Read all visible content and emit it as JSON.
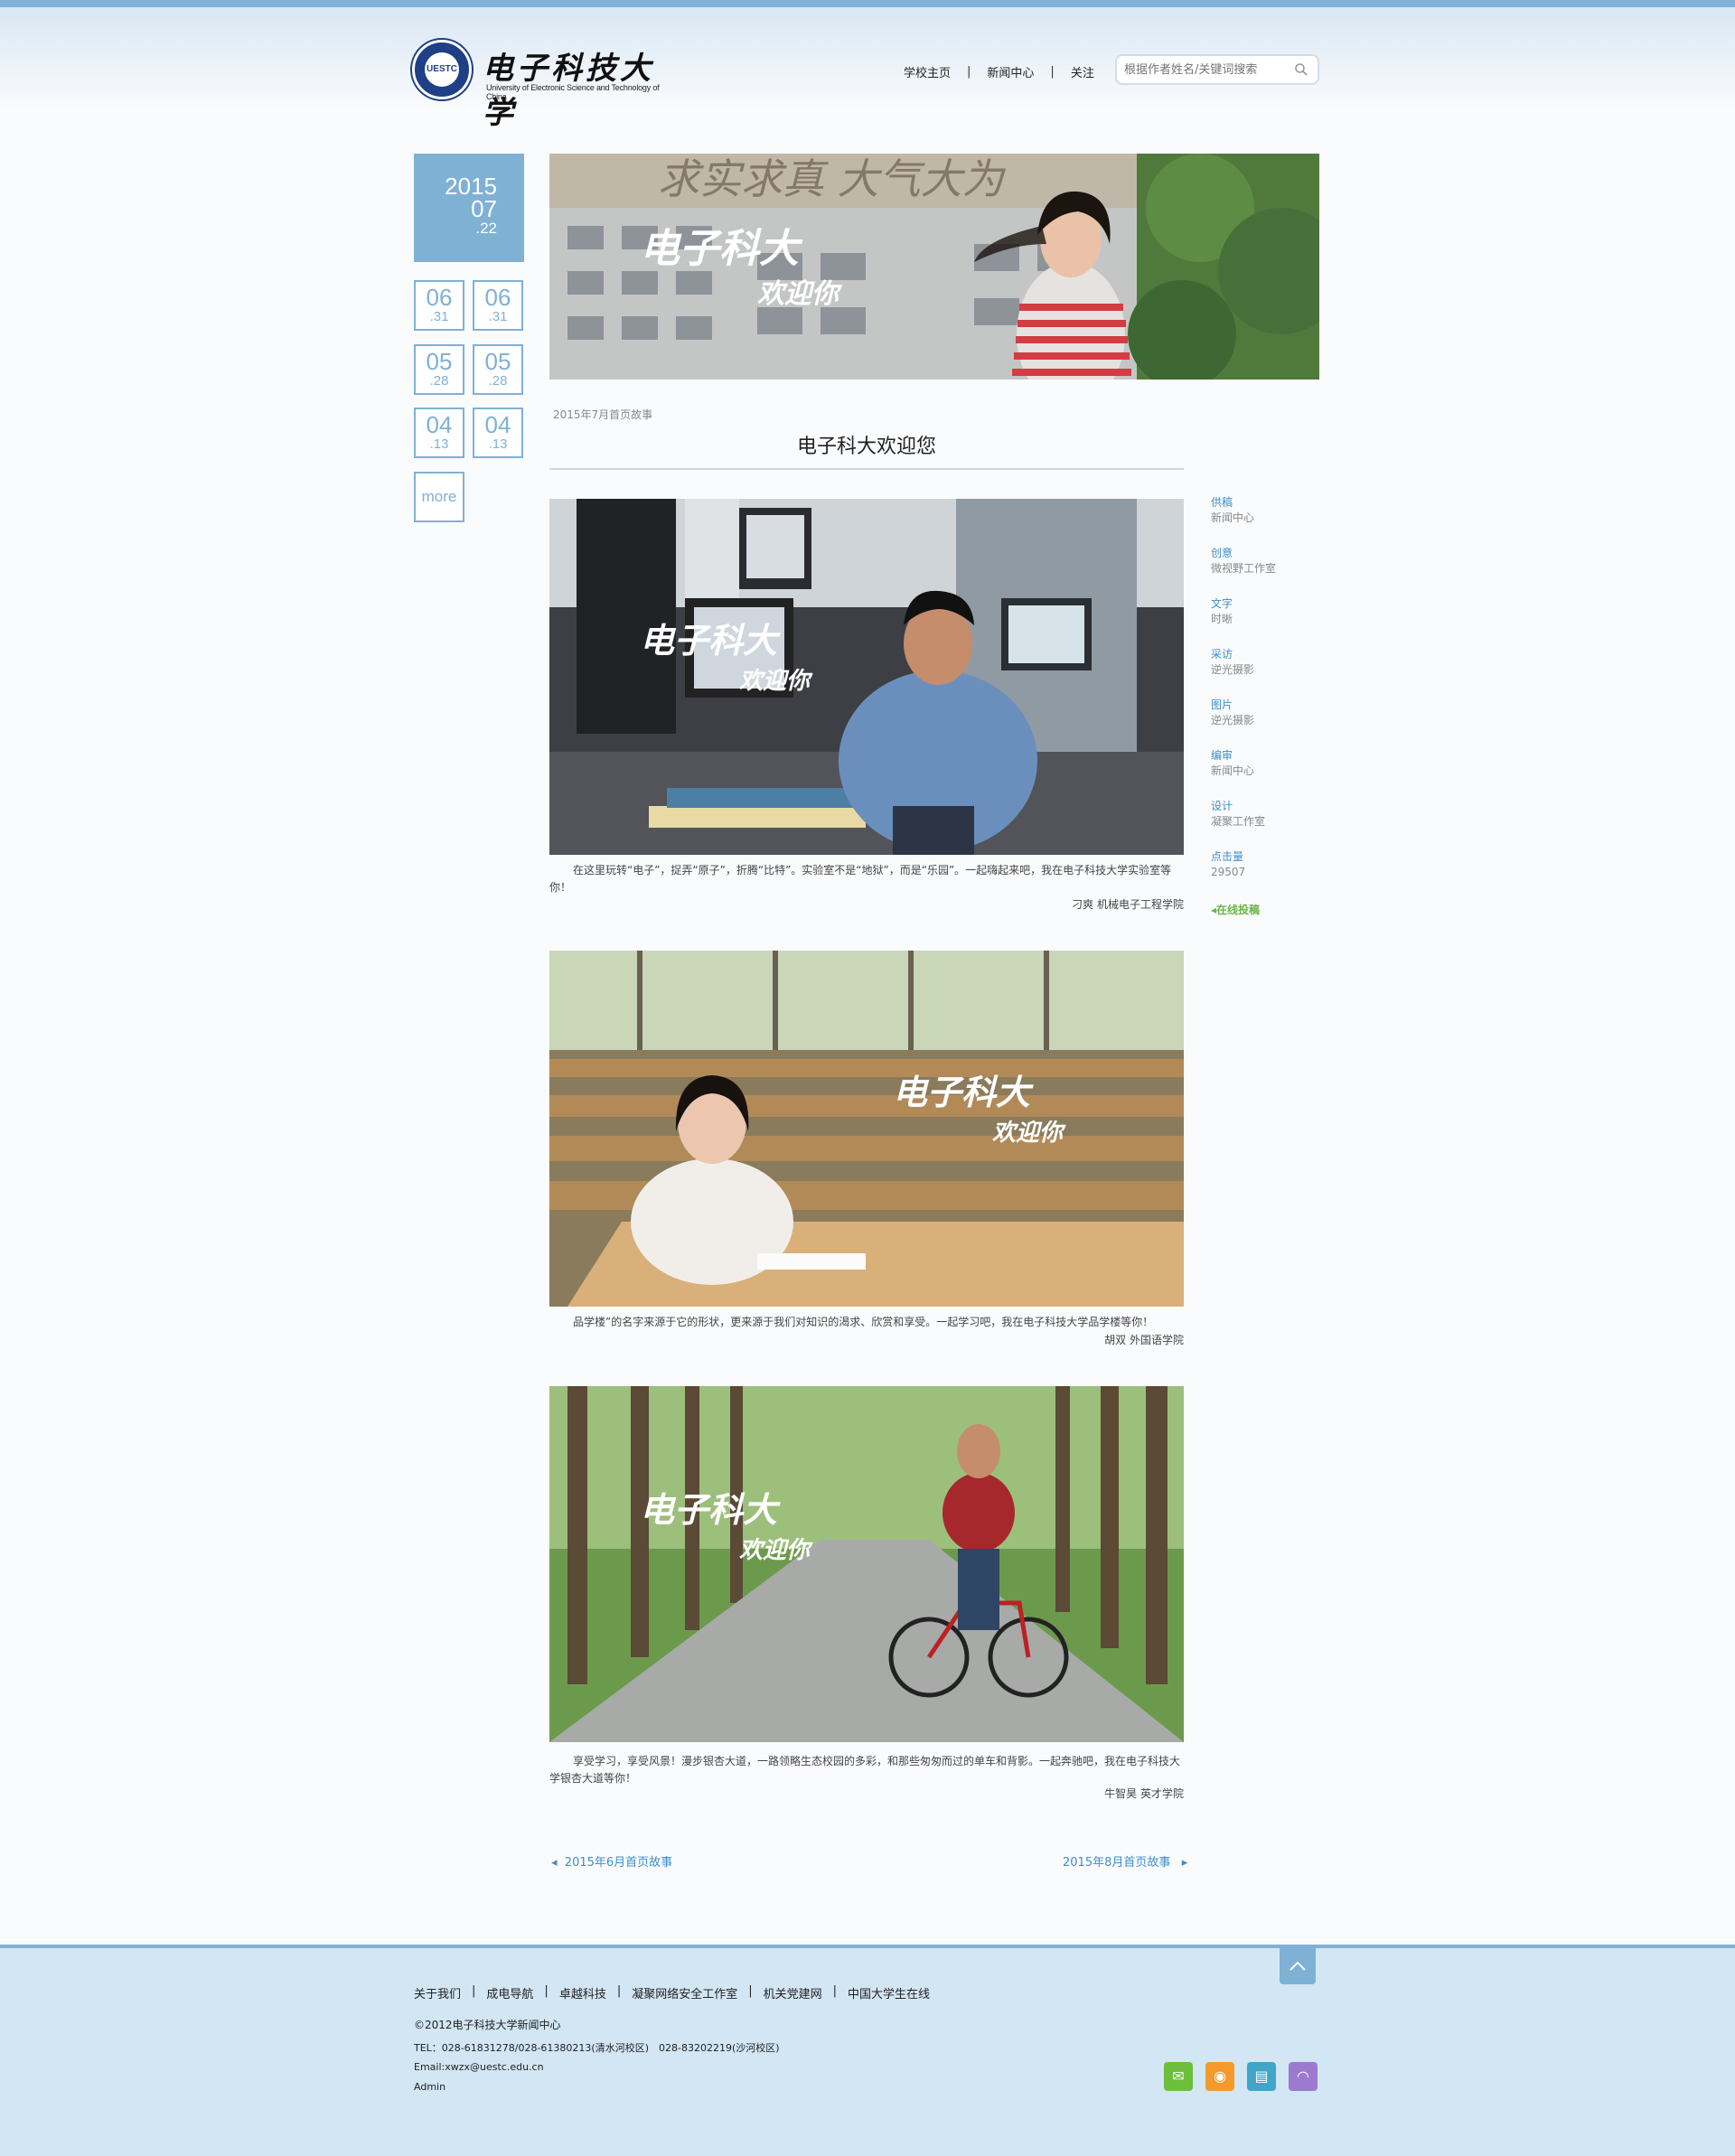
{
  "header": {
    "logo_cn": "电子科技大学",
    "logo_en": "University of Electronic Science and Technology of China",
    "logo_badge": "UESTC",
    "nav": [
      "学校主页",
      "新闻中心",
      "关注"
    ],
    "search_placeholder": "根据作者姓名/关键词搜索"
  },
  "dates": {
    "current": {
      "year": "2015",
      "month": "07",
      "day": ".22"
    },
    "archive": [
      {
        "month": "06",
        "day": ".31"
      },
      {
        "month": "06",
        "day": ".31"
      },
      {
        "month": "05",
        "day": ".28"
      },
      {
        "month": "05",
        "day": ".28"
      },
      {
        "month": "04",
        "day": ".13"
      },
      {
        "month": "04",
        "day": ".13"
      }
    ],
    "more": "more"
  },
  "hero": {
    "wall_text": "求实求真 大气大为",
    "wm_line1": "电子科大",
    "wm_line2": "欢迎你"
  },
  "article": {
    "kicker": "2015年7月首页故事",
    "title": "电子科大欢迎您",
    "photos": [
      {
        "caption": "在这里玩转“电子”，捉弄“原子”，折腾“比特”。实验室不是“地狱”，而是“乐园”。一起嗨起来吧，我在电子科技大学实验室等你！",
        "credit": "刁爽 机械电子工程学院"
      },
      {
        "caption": "品学楼”的名字来源于它的形状，更来源于我们对知识的渴求、欣赏和享受。一起学习吧，我在电子科技大学品学楼等你！",
        "credit": "胡双 外国语学院"
      },
      {
        "caption": "享受学习，享受风景！漫步银杏大道，一路领略生态校园的多彩，和那些匆匆而过的单车和背影。一起奔驰吧，我在电子科技大学银杏大道等你！",
        "credit": "牛智昊 英才学院"
      }
    ],
    "wm_line1": "电子科大",
    "wm_line2": "欢迎你"
  },
  "credits": [
    {
      "label": "供稿",
      "value": "新闻中心"
    },
    {
      "label": "创意",
      "value": "微视野工作室"
    },
    {
      "label": "文字",
      "value": "时晰"
    },
    {
      "label": "采访",
      "value": "逆光摄影"
    },
    {
      "label": "图片",
      "value": "逆光摄影"
    },
    {
      "label": "编审",
      "value": "新闻中心"
    },
    {
      "label": "设计",
      "value": "凝聚工作室"
    },
    {
      "label": "点击量",
      "value": "29507"
    }
  ],
  "submit_label": "在线投稿",
  "pager": {
    "prev": "2015年6月首页故事",
    "next": "2015年8月首页故事"
  },
  "footer": {
    "links": [
      "关于我们",
      "成电导航",
      "卓越科技",
      "凝聚网络安全工作室",
      "机关党建网",
      "中国大学生在线"
    ],
    "copyright": "©2012电子科技大学新闻中心",
    "tel": "TEL：028-61831278/028-61380213(清水河校区)　028-83202219(沙河校区)",
    "email": "Email:xwzx@uestc.edu.cn",
    "admin": "Admin"
  },
  "colors": {
    "accent": "#7fb1d5",
    "link": "#3f8ec9",
    "green": "#6bb54a"
  },
  "social_icons": [
    "wechat-icon",
    "weibo-icon",
    "book-icon",
    "rss-icon"
  ]
}
